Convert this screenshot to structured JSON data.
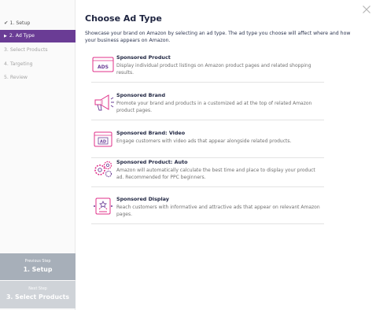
{
  "sidebar": {
    "steps": [
      {
        "label": "1. Setup",
        "state": "done"
      },
      {
        "label": "2. Ad Type",
        "state": "active"
      },
      {
        "label": "3. Select Products",
        "state": "upcoming"
      },
      {
        "label": "4. Targeting",
        "state": "upcoming"
      },
      {
        "label": "5. Review",
        "state": "upcoming"
      }
    ],
    "previous": {
      "caption": "Previous Step",
      "label": "1. Setup"
    },
    "next": {
      "caption": "Next Step",
      "label": "3. Select Products"
    }
  },
  "main": {
    "title": "Choose Ad Type",
    "description": "Showcase your brand on Amazon by selecting an ad type. The ad type you choose will affect where and how your business appears on Amazon.",
    "ad_types": [
      {
        "name": "Sponsored Product",
        "description": "Display individual product listings on Amazon product pages and related shopping results.",
        "icon": "ads-icon"
      },
      {
        "name": "Sponsored Brand",
        "description": "Promote your brand and products in a customized ad at the top of related Amazon product pages.",
        "icon": "megaphone-icon"
      },
      {
        "name": "Sponsored Brand: Video",
        "description": "Engage customers with video ads that appear alongside related products.",
        "icon": "video-ad-icon"
      },
      {
        "name": "Sponsored Product: Auto",
        "description": "Amazon will automatically calculate the best time and place to display your product ad. Recommended for PPC beginners.",
        "icon": "gears-icon"
      },
      {
        "name": "Sponsored Display",
        "description": "Reach customers with informative and attractive ads that appear on relevant Amazon pages.",
        "icon": "display-ad-icon"
      }
    ]
  },
  "icons": {
    "close": "close-icon",
    "check": "checkmark-icon",
    "active_marker": "triangle-right-icon"
  },
  "colors": {
    "accent": "#6a3c95",
    "icon_pink": "#e0328a",
    "prev_button": "#a7afb9",
    "next_button": "#cfd3d8"
  }
}
